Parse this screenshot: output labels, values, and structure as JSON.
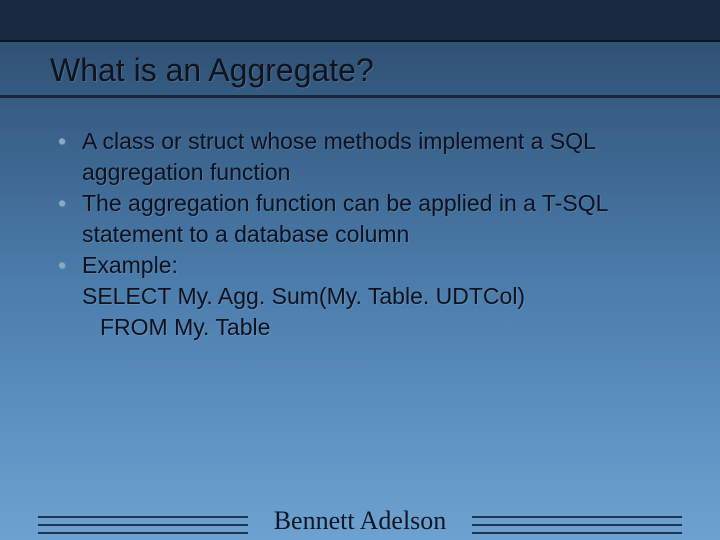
{
  "slide": {
    "title": "What is an Aggregate?",
    "bullets": [
      {
        "text": "A class or struct whose methods implement a SQL aggregation function"
      },
      {
        "text": "The aggregation function can be applied in a T-SQL statement to a database column"
      },
      {
        "text": "Example:",
        "lines": [
          "SELECT My. Agg. Sum(My. Table. UDTCol)",
          "FROM My. Table"
        ]
      }
    ],
    "footer": "Bennett Adelson"
  }
}
